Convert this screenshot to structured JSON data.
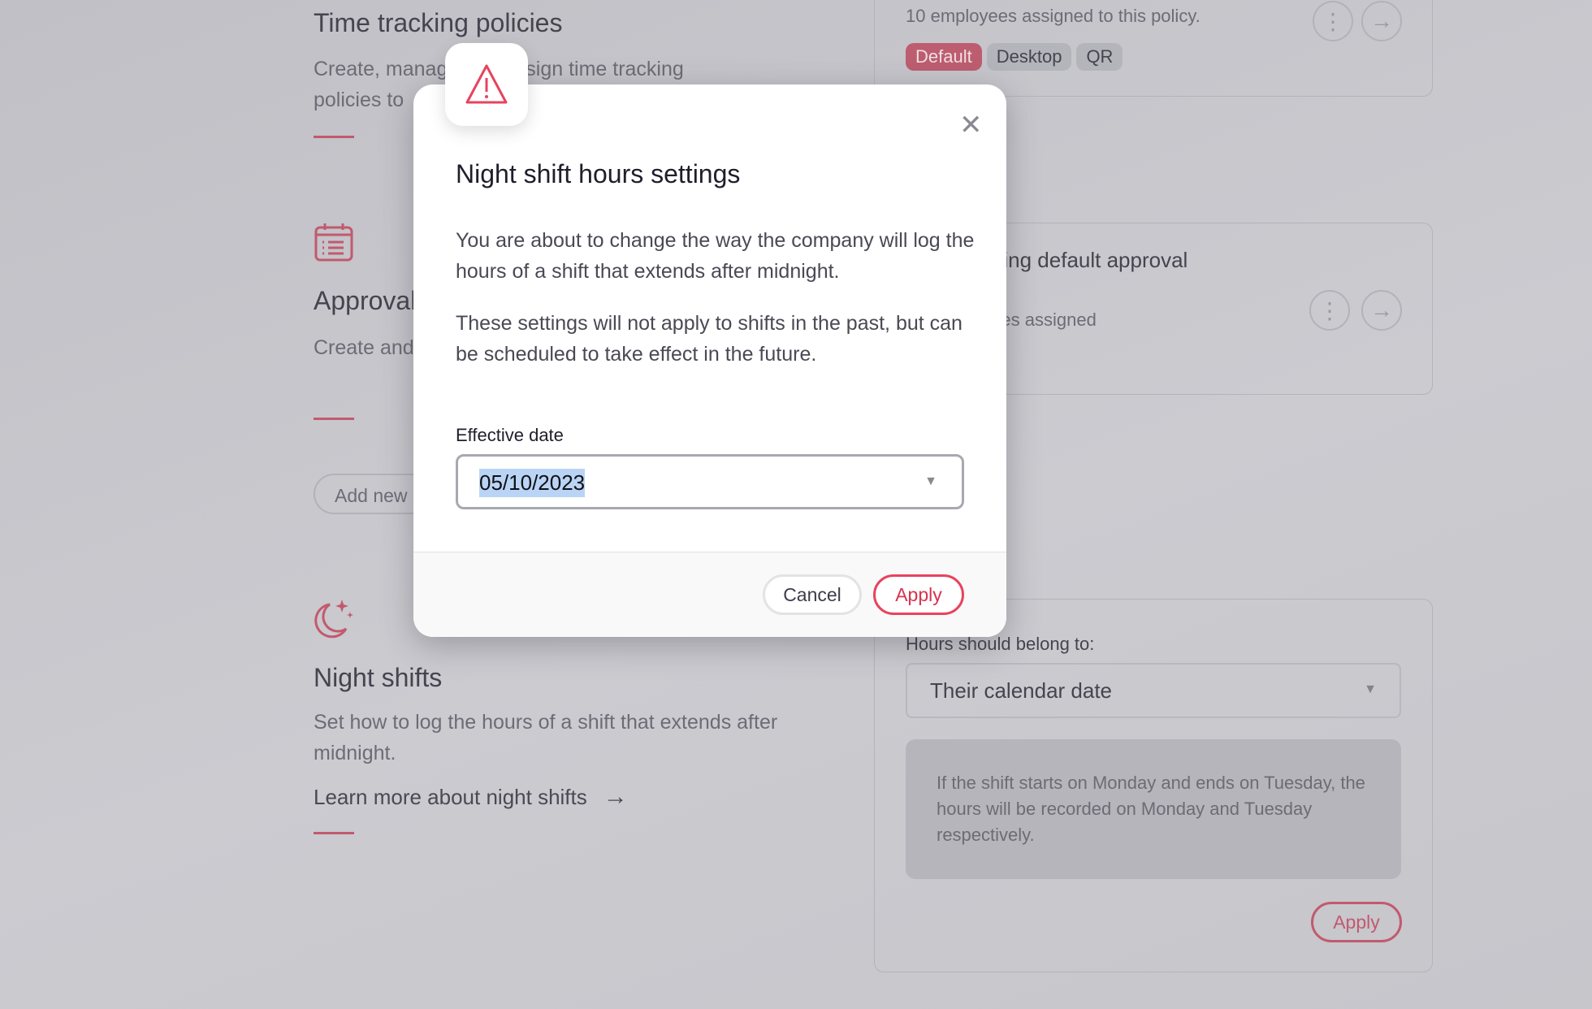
{
  "background": {
    "time_tracking": {
      "title": "Time tracking policies",
      "description": "Create, manage and assign time tracking policies to"
    },
    "approvals": {
      "title": "Approvals",
      "description": "Create and manage your",
      "add_button": "Add new"
    },
    "night_shifts": {
      "title": "Night shifts",
      "description": "Set how to log the hours of a shift that extends after midnight.",
      "link": "Learn more about night shifts"
    },
    "policy_card": {
      "assigned": "10 employees assigned to this policy.",
      "tags": [
        "Default",
        "Desktop",
        "QR"
      ]
    },
    "approval_card": {
      "title": "Time tracking default approval",
      "assigned": "No employees assigned"
    },
    "night_card": {
      "label": "Hours should belong to:",
      "select_value": "Their calendar date",
      "info": "If the shift starts on Monday and ends on Tuesday, the hours will be recorded on Monday and Tuesday respectively.",
      "apply": "Apply"
    }
  },
  "modal": {
    "icon": "warning-icon",
    "title": "Night shift hours settings",
    "paragraph1": "You are about to change the way the company will log the hours of a shift that extends after midnight.",
    "paragraph2": "These settings will not apply to shifts in the past, but can be scheduled to take effect in the future.",
    "date_label": "Effective date",
    "date_value": "05/10/2023",
    "cancel": "Cancel",
    "apply": "Apply"
  },
  "colors": {
    "accent": "#e8435e",
    "overlay": "#c5c5cb"
  }
}
